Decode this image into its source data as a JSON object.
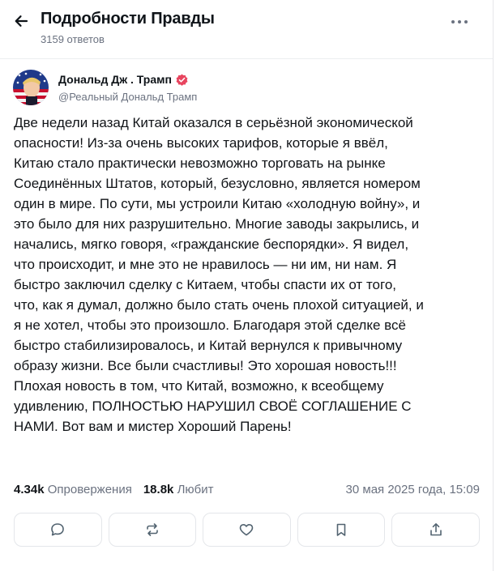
{
  "header": {
    "title": "Подробности Правды",
    "replies_count": "3159 ответов"
  },
  "post": {
    "author_name": "Дональд Дж . Трамп",
    "author_handle": "@Реальный Дональд Трамп",
    "text_lines": [
      "Две недели назад Китай оказался в серьёзной экономической",
      "опасности! Из-за очень высоких тарифов, которые я ввёл,",
      "Китаю стало практически невозможно торговать на рынке",
      "Соединённых Штатов, который, безусловно, является номером",
      "один в мире. По сути, мы устроили Китаю «холодную войну», и",
      "это было для них разрушительно. Многие заводы закрылись, и",
      "начались, мягко говоря, «гражданские беспорядки». Я видел,",
      "что происходит, и мне это не нравилось — ни им, ни нам. Я",
      "быстро заключил сделку с Китаем, чтобы спасти их от того,",
      "что, как я думал, должно было стать очень плохой ситуацией, и",
      "я не хотел, чтобы это произошло. Благодаря этой сделке всё",
      "быстро стабилизировалось, и Китай вернулся к привычному",
      "образу жизни. Все были счастливы! Это хорошая новость!!!",
      "Плохая новость в том, что Китай, возможно, к всеобщему",
      "удивлению, ПОЛНОСТЬЮ НАРУШИЛ СВОЁ СОГЛАШЕНИЕ С",
      "НАМИ. Вот вам и мистер Хороший Парень!"
    ],
    "stats": {
      "retruths_count": "4.34k",
      "retruths_label": "Опровержения",
      "likes_count": "18.8k",
      "likes_label": "Любит",
      "date": "30 мая 2025 года, 15:09"
    }
  },
  "icons": {
    "back": "arrow-left-icon",
    "more": "more-horizontal-icon",
    "verified": "verified-badge-icon",
    "reply": "comment-icon",
    "retruth": "repost-icon",
    "like": "heart-icon",
    "bookmark": "bookmark-icon",
    "share": "share-icon"
  },
  "colors": {
    "verified_badge": "#e8455f",
    "muted_text": "#6b7280",
    "border": "#e4e6ea"
  }
}
